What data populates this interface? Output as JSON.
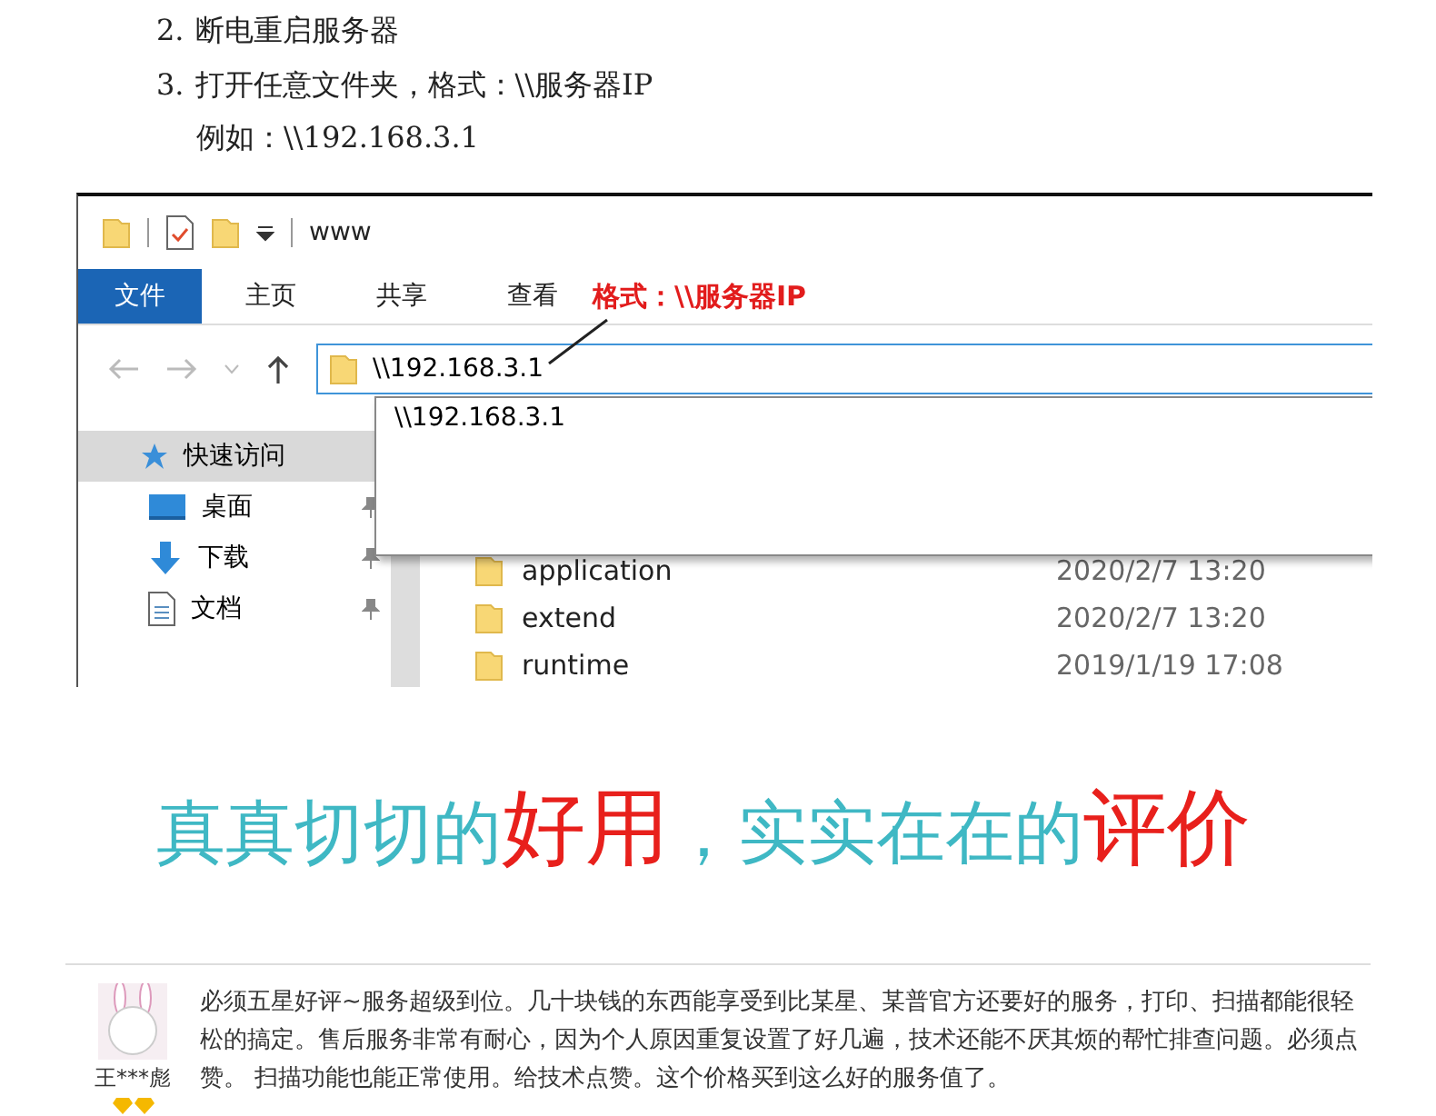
{
  "steps": [
    {
      "number": "2.",
      "text": "断电重启服务器"
    },
    {
      "number": "3.",
      "text": "打开任意文件夹，格式：\\\\服务器IP"
    }
  ],
  "example": "例如：\\\\192.168.3.1",
  "explorer": {
    "title": "www",
    "tabs": [
      {
        "label": "文件",
        "selected": true
      },
      {
        "label": "主页",
        "selected": false
      },
      {
        "label": "共享",
        "selected": false
      },
      {
        "label": "查看",
        "selected": false
      }
    ],
    "annotation": "格式：\\\\服务器IP",
    "address": "\\\\192.168.3.1",
    "suggestion": "\\\\192.168.3.1",
    "nav": [
      {
        "label": "快速访问",
        "kind": "star",
        "selected": true,
        "pinned": false
      },
      {
        "label": "桌面",
        "kind": "desktop",
        "selected": false,
        "pinned": true
      },
      {
        "label": "下载",
        "kind": "download",
        "selected": false,
        "pinned": true
      },
      {
        "label": "文档",
        "kind": "document",
        "selected": false,
        "pinned": true
      }
    ],
    "files": [
      {
        "name": "application",
        "date": "2020/2/7 13:20"
      },
      {
        "name": "extend",
        "date": "2020/2/7 13:20"
      },
      {
        "name": "runtime",
        "date": "2019/1/19 17:08"
      }
    ]
  },
  "slogan": [
    {
      "text": "真真切切的",
      "kind": "plain"
    },
    {
      "text": "好用",
      "kind": "accent"
    },
    {
      "text": "，实实在在的",
      "kind": "plain"
    },
    {
      "text": "评价",
      "kind": "accent"
    }
  ],
  "review": {
    "user": "王***彪",
    "text": "必须五星好评~服务超级到位。几十块钱的东西能享受到比某星、某普官方还要好的服务，打印、扫描都能很轻松的搞定。售后服务非常有耐心，因为个人原因重复设置了好几遍，技术还能不厌其烦的帮忙排查问题。必须点赞。 扫描功能也能正常使用。给技术点赞。这个价格买到这么好的服务值了。"
  }
}
